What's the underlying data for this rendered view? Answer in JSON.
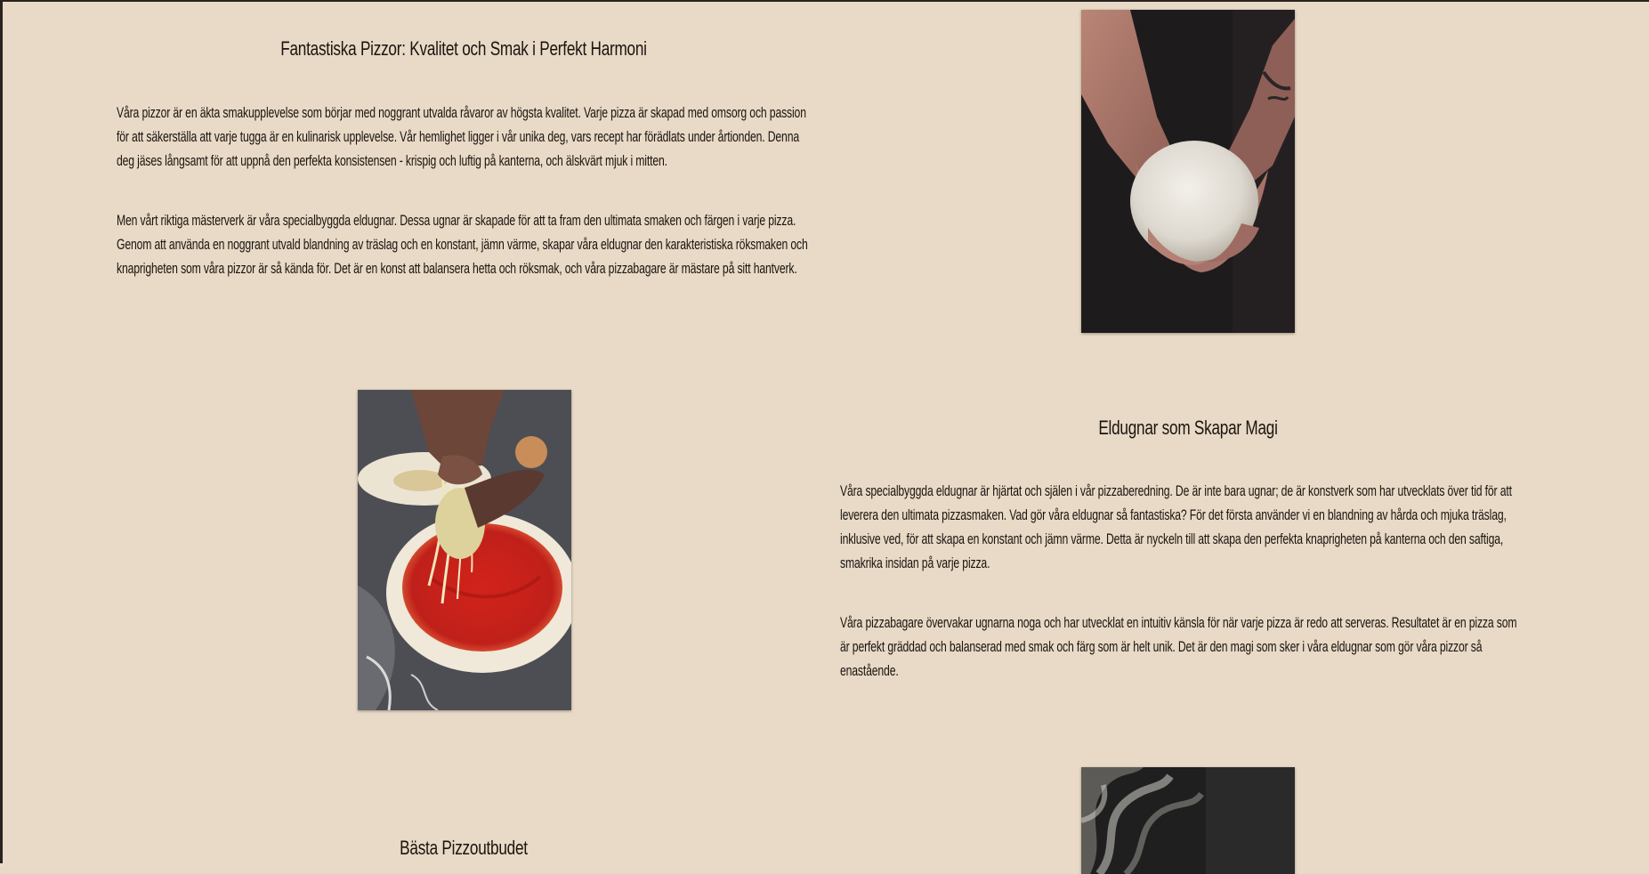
{
  "sections": [
    {
      "title": "Fantastiska Pizzor: Kvalitet och Smak i Perfekt Harmoni",
      "paragraphs": [
        "Våra pizzor är en äkta smakupplevelse som börjar med noggrant utvalda råvaror av högsta kvalitet. Varje pizza är skapad med omsorg och passion för att säkerställa att varje tugga är en kulinarisk upplevelse. Vår hemlighet ligger i vår unika deg, vars recept har förädlats under årtionden. Denna deg jäses långsamt för att uppnå den perfekta konsistensen - krispig och luftig på kanterna, och älskvärt mjuk i mitten.",
        "Men vårt riktiga mästerverk är våra specialbyggda eldugnar. Dessa ugnar är skapade för att ta fram den ultimata smaken och färgen i varje pizza. Genom att använda en noggrant utvald blandning av träslag och en konstant, jämn värme, skapar våra eldugnar den karakteristiska röksmaken och knaprigheten som våra pizzor är så kända för. Det är en konst att balansera hetta och röksmak, och våra pizzabagare är mästare på sitt hantverk."
      ],
      "image": "dough-ball-hands-photo"
    },
    {
      "title": "Eldugnar som Skapar Magi",
      "paragraphs": [
        "Våra specialbyggda eldugnar är hjärtat och själen i vår pizzaberedning. De är inte bara ugnar; de är konstverk som har utvecklats över tid för att leverera den ultimata pizzasmaken. Vad gör våra eldugnar så fantastiska? För det första använder vi en blandning av hårda och mjuka träslag, inklusive ved, för att skapa en konstant och jämn värme. Detta är nyckeln till att skapa den perfekta knaprigheten på kanterna och den saftiga, smakrika insidan på varje pizza.",
        "Våra pizzabagare övervakar ugnarna noga och har utvecklat en intuitiv känsla för när varje pizza är redo att serveras. Resultatet är en pizza som är perfekt gräddad och balanserad med smak och färg som är helt unik. Det är den magi som sker i våra eldugnar som gör våra pizzor så enastående."
      ],
      "image": "pizza-topping-photo"
    },
    {
      "title": "Bästa Pizzoutbudet",
      "paragraphs": [],
      "image": "smoke-photo"
    }
  ]
}
